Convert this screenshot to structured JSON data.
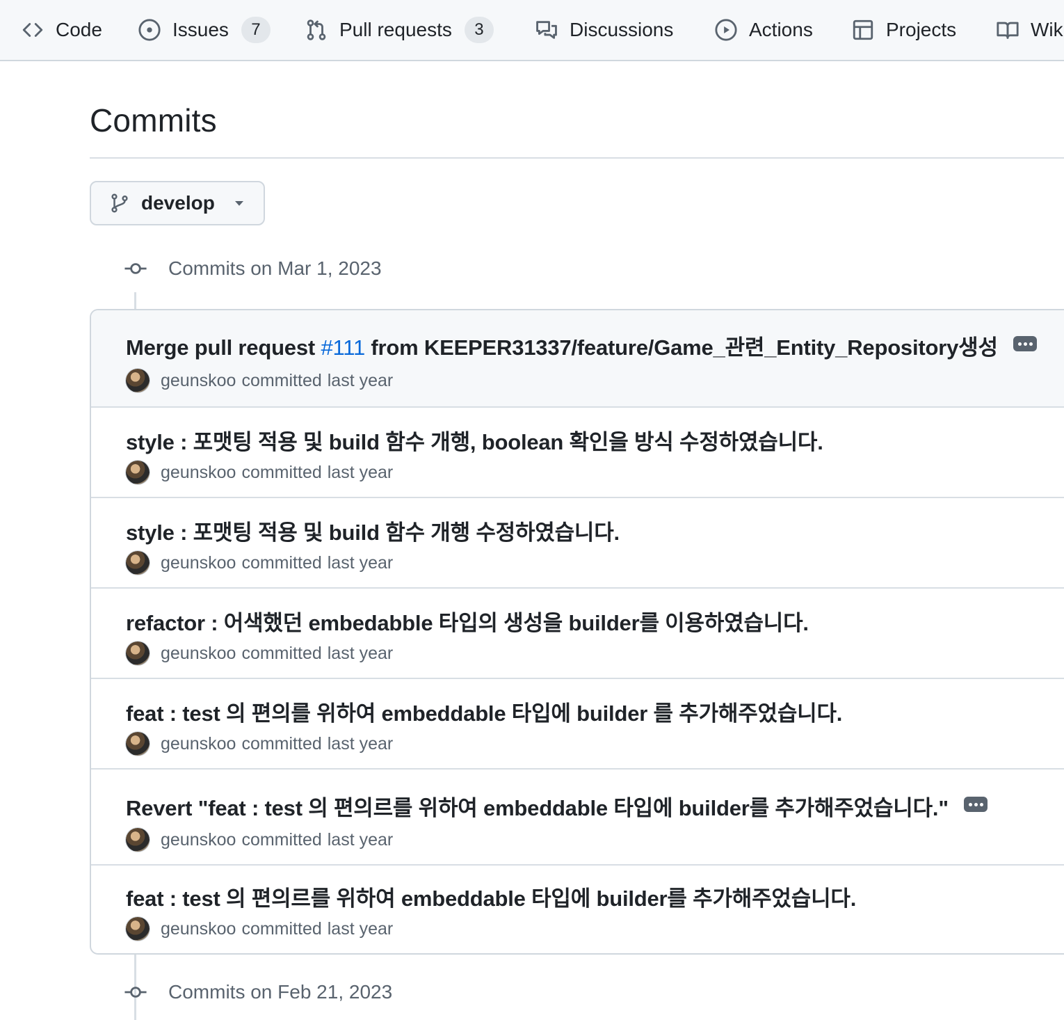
{
  "nav": {
    "items": [
      {
        "label": "Code",
        "icon": "code-icon"
      },
      {
        "label": "Issues",
        "icon": "issue-icon",
        "count": "7"
      },
      {
        "label": "Pull requests",
        "icon": "pull-request-icon",
        "count": "3"
      },
      {
        "label": "Discussions",
        "icon": "discussions-icon"
      },
      {
        "label": "Actions",
        "icon": "actions-play-icon"
      },
      {
        "label": "Projects",
        "icon": "projects-table-icon"
      },
      {
        "label": "Wik",
        "icon": "book-icon"
      }
    ]
  },
  "page": {
    "title": "Commits",
    "branch": "develop"
  },
  "groups": [
    {
      "header": "Commits on Mar 1, 2023",
      "commits": [
        {
          "message_prefix": "Merge pull request ",
          "pr_link": "#111",
          "message_suffix": " from KEEPER31337/feature/Game_관련_Entity_Repository생성",
          "author": "geunskoo",
          "action": "committed",
          "time": "last year"
        },
        {
          "message": "style : 포맷팅 적용 및 build 함수 개행, boolean 확인을 방식 수정하였습니다.",
          "author": "geunskoo",
          "action": "committed",
          "time": "last year"
        },
        {
          "message": "style : 포맷팅 적용 및 build 함수 개행 수정하였습니다.",
          "author": "geunskoo",
          "action": "committed",
          "time": "last year"
        },
        {
          "message": "refactor : 어색했던 embedabble 타입의 생성을 builder를 이용하였습니다.",
          "author": "geunskoo",
          "action": "committed",
          "time": "last year"
        },
        {
          "message": "feat : test 의 편의를 위하여 embeddable 타입에 builder 를 추가해주었습니다.",
          "author": "geunskoo",
          "action": "committed",
          "time": "last year"
        },
        {
          "message": "Revert \"feat : test 의 편의르를 위하여 embeddable 타입에 builder를 추가해주었습니다.\"",
          "author": "geunskoo",
          "action": "committed",
          "time": "last year"
        },
        {
          "message": "feat : test 의 편의르를 위하여 embeddable 타입에 builder를 추가해주었습니다.",
          "author": "geunskoo",
          "action": "committed",
          "time": "last year"
        }
      ]
    },
    {
      "header": "Commits on Feb 21, 2023"
    }
  ],
  "colors": {
    "link": "#0969da",
    "muted": "#59636e",
    "border": "#d0d7de",
    "subtle_bg": "#f6f8fa"
  }
}
